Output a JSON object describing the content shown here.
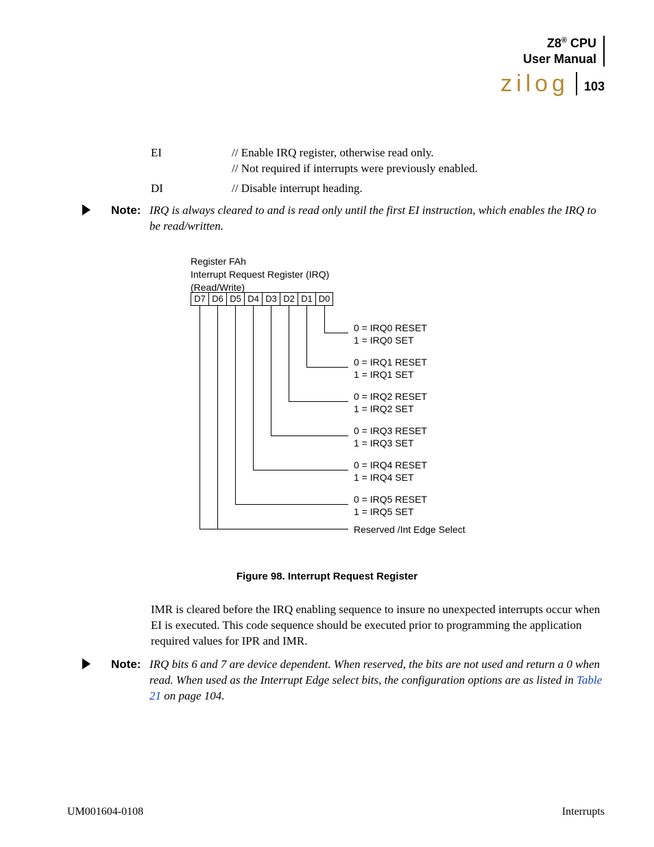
{
  "header": {
    "title_line1_prefix": "Z8",
    "title_line1_sup": "®",
    "title_line1_suffix": " CPU",
    "title_line2": "User Manual",
    "logo": "zilog",
    "page_number": "103"
  },
  "code": {
    "rows": [
      {
        "mnemonic": "EI",
        "comment1": "// Enable IRQ register, otherwise read only.",
        "comment2": "// Not required if interrupts were previously enabled."
      },
      {
        "mnemonic": "DI",
        "comment1": "// Disable interrupt heading.",
        "comment2": ""
      }
    ]
  },
  "note1": {
    "label": "Note:",
    "text": "IRQ is always cleared to          and is read only until the first EI instruction, which enables the IRQ to be read/written."
  },
  "diagram": {
    "header_line1": "Register FAh",
    "header_line2": "Interrupt Request Register (IRQ)",
    "header_line3": "(Read/Write)",
    "bits": [
      "D7",
      "D6",
      "D5",
      "D4",
      "D3",
      "D2",
      "D1",
      "D0"
    ],
    "labels": {
      "d0a": "0 = IRQ0 RESET",
      "d0b": "1 = IRQ0 SET",
      "d1a": "0 = IRQ1 RESET",
      "d1b": "1 = IRQ1 SET",
      "d2a": "0 = IRQ2 RESET",
      "d2b": "1 = IRQ2 SET",
      "d3a": "0 = IRQ3 RESET",
      "d3b": "1 = IRQ3 SET",
      "d4a": "0 = IRQ4 RESET",
      "d4b": "1 = IRQ4 SET",
      "d5a": "0 = IRQ5 RESET",
      "d5b": "1 = IRQ5 SET",
      "reserved": "Reserved /Int Edge Select"
    },
    "caption": "Figure 98. Interrupt Request Register"
  },
  "para2": "IMR is cleared before the IRQ enabling sequence to insure no unexpected interrupts occur when EI is executed. This code sequence should be executed prior to programming the application required values for IPR and IMR.",
  "note2": {
    "label": "Note:",
    "text_a": "IRQ bits 6 and 7 are device dependent. When reserved, the bits are not used and return a 0 when read. When used as the Interrupt Edge select bits, the configuration options are as listed in ",
    "link": "Table 21",
    "text_b": " on page 104."
  },
  "footer": {
    "left": "UM001604-0108",
    "right": "Interrupts"
  }
}
